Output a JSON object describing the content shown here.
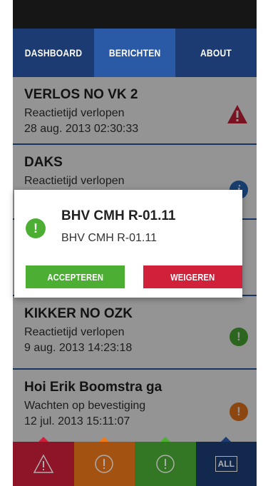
{
  "tabs": [
    {
      "label": "DASHBOARD",
      "active": false
    },
    {
      "label": "BERICHTEN",
      "active": true
    },
    {
      "label": "ABOUT",
      "active": false
    }
  ],
  "messages": [
    {
      "title": "VERLOS NO VK 2",
      "status": "Reactietijd verlopen",
      "date": "28 aug. 2013 02:30:33",
      "icon": "alert-triangle-icon",
      "color": "#d0203a"
    },
    {
      "title": "DAKS",
      "status": "Reactietijd verlopen",
      "date": "",
      "icon": "info-icon",
      "color": "#2a6bc2"
    },
    {
      "title": "",
      "status": "",
      "date": "",
      "icon": "",
      "color": ""
    },
    {
      "title": "KIKKER NO OZK",
      "status": "Reactietijd verlopen",
      "date": "9 aug. 2013 14:23:18",
      "icon": "exclamation-icon",
      "color": "#4caf34"
    },
    {
      "title": "Hoi Erik Boomstra ga",
      "status": "Wachten op bevestiging",
      "date": "12 jul. 2013 15:11:07",
      "icon": "exclamation-icon",
      "color": "#f07a1a"
    }
  ],
  "dialog": {
    "title": "BHV CMH R-01.11",
    "subtitle": "BHV CMH R-01.11",
    "accept_label": "ACCEPTEREN",
    "decline_label": "WEIGEREN",
    "icon_color": "#4caf34"
  },
  "bottom_filters": [
    {
      "icon": "warning-filter-icon",
      "color": "#d0203a"
    },
    {
      "icon": "orange-filter-icon",
      "color": "#f07a1a"
    },
    {
      "icon": "green-filter-icon",
      "color": "#4caf34"
    },
    {
      "label": "ALL",
      "color": "#1b3b72"
    }
  ]
}
